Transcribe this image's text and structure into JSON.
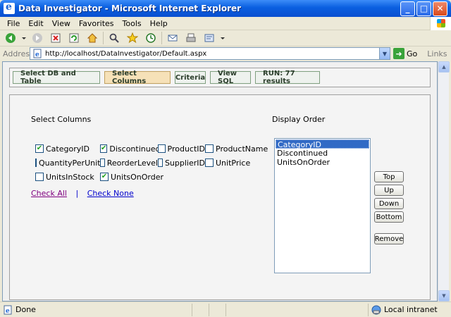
{
  "window": {
    "title": "Data Investigator - Microsoft Internet Explorer",
    "minimize": "_",
    "maximize": "□",
    "close": "✕"
  },
  "menu": [
    "File",
    "Edit",
    "View",
    "Favorites",
    "Tools",
    "Help"
  ],
  "toolbar": {
    "icons": [
      "back-icon",
      "forward-icon",
      "stop-icon",
      "refresh-icon",
      "home-icon",
      "search-icon",
      "favorites-icon",
      "history-icon",
      "mail-icon",
      "print-icon",
      "edit-icon"
    ]
  },
  "address": {
    "label": "Address",
    "url": "http://localhost/DataInvestigator/Default.aspx",
    "go": "Go",
    "links": "Links",
    "chevron": "»"
  },
  "tabs": [
    {
      "label": "Select DB and Table",
      "active": false
    },
    {
      "label": "Select Columns",
      "active": true
    },
    {
      "label": "Criteria",
      "active": false
    },
    {
      "label": "View SQL",
      "active": false
    },
    {
      "label": "RUN: 77 results",
      "active": false
    }
  ],
  "columns": {
    "heading": "Select Columns",
    "items": [
      {
        "label": "CategoryID",
        "checked": true
      },
      {
        "label": "Discontinued",
        "checked": true
      },
      {
        "label": "ProductID",
        "checked": false
      },
      {
        "label": "ProductName",
        "checked": false
      },
      {
        "label": "QuantityPerUnit",
        "checked": false
      },
      {
        "label": "ReorderLevel",
        "checked": false
      },
      {
        "label": "SupplierID",
        "checked": false
      },
      {
        "label": "UnitPrice",
        "checked": false
      },
      {
        "label": "UnitsInStock",
        "checked": false
      },
      {
        "label": "UnitsOnOrder",
        "checked": true
      }
    ],
    "check_all": "Check All",
    "separator": "|",
    "check_none": "Check None"
  },
  "order": {
    "heading": "Display Order",
    "items": [
      "CategoryID",
      "Discontinued",
      "UnitsOnOrder"
    ],
    "selected_index": 0,
    "buttons": {
      "top": "Top",
      "up": "Up",
      "down": "Down",
      "bottom": "Bottom",
      "remove": "Remove"
    }
  },
  "status": {
    "text": "Done",
    "zone": "Local intranet"
  },
  "colors": {
    "title_bar": "#0a5fe0",
    "active_tab": "#f6e1b8",
    "list_selection": "#316ac5",
    "check_mark": "#21a121"
  }
}
